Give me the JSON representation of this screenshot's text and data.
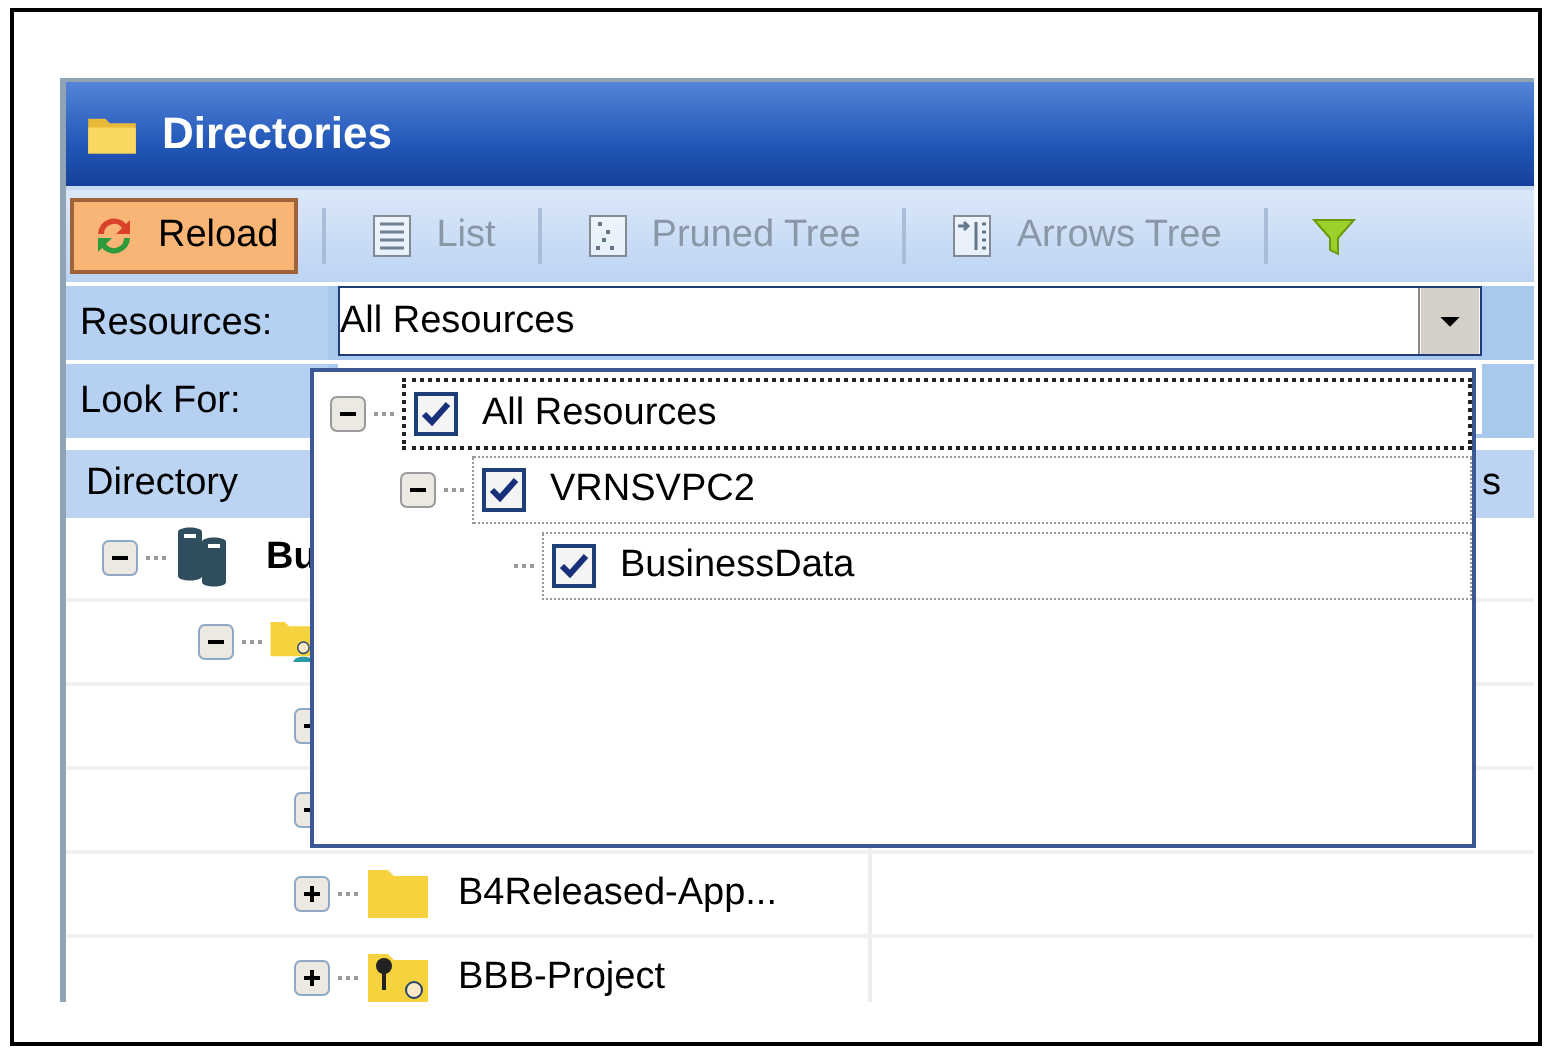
{
  "window": {
    "title": "Directories"
  },
  "toolbar": [
    {
      "label": "Reload",
      "selected": true,
      "disabled": false
    },
    {
      "label": "List",
      "selected": false,
      "disabled": true
    },
    {
      "label": "Pruned Tree",
      "selected": false,
      "disabled": true
    },
    {
      "label": "Arrows Tree",
      "selected": false,
      "disabled": true
    },
    {
      "selected": false,
      "disabled": false
    }
  ],
  "filters": [
    {
      "label": "Resources:",
      "kind": "dropdown",
      "value": "All Resources"
    },
    {
      "label": "Look For:",
      "kind": "text"
    }
  ],
  "columns": [
    {
      "label": "Directory"
    },
    {
      "label": "s"
    }
  ],
  "tree": [
    {
      "label": "Bu",
      "kind": "database",
      "expanded": true,
      "children": [
        {
          "kind": "shared-folder",
          "expanded": true,
          "children": [
            {
              "expanded": false
            },
            {
              "expanded": false
            },
            {
              "label": "B4Released-App...",
              "kind": "folder",
              "expanded": false
            },
            {
              "label": "BBB-Project",
              "kind": "locked-folder",
              "expanded": false
            }
          ]
        }
      ]
    }
  ],
  "dropdown_tree": [
    {
      "label": "All Resources",
      "checked": true,
      "expanded": true,
      "selected": true,
      "children": [
        {
          "label": "VRNSVPC2",
          "checked": true,
          "expanded": true,
          "selected": false,
          "children": [
            {
              "label": "BusinessData",
              "checked": true,
              "selected": false
            }
          ]
        }
      ]
    }
  ]
}
